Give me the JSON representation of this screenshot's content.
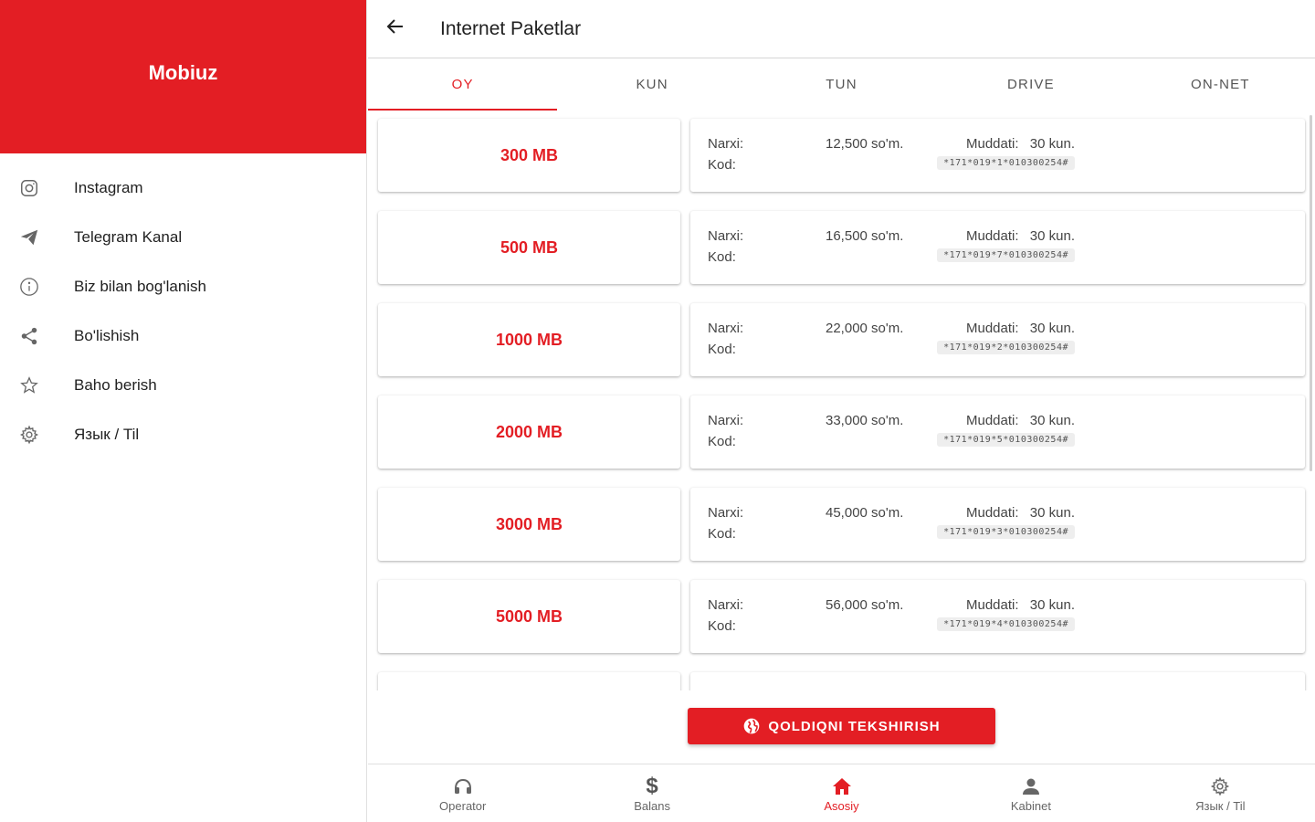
{
  "drawer": {
    "title": "Mobiuz",
    "header_color": "#e31e24",
    "items": [
      {
        "label": "Instagram",
        "icon": "instagram-icon"
      },
      {
        "label": "Telegram Kanal",
        "icon": "telegram-icon"
      },
      {
        "label": "Biz bilan bog'lanish",
        "icon": "info-icon"
      },
      {
        "label": "Bo'lishish",
        "icon": "share-icon"
      },
      {
        "label": "Baho berish",
        "icon": "star-icon"
      },
      {
        "label": "Язык / Til",
        "icon": "gear-icon"
      }
    ]
  },
  "appbar": {
    "title": "Internet Paketlar",
    "back_icon": "arrow-left-icon"
  },
  "tabs": [
    {
      "label": "OY",
      "active": true
    },
    {
      "label": "KUN",
      "active": false
    },
    {
      "label": "TUN",
      "active": false
    },
    {
      "label": "DRIVE",
      "active": false
    },
    {
      "label": "ON-NET",
      "active": false
    }
  ],
  "packages": [
    {
      "size": "300 MB",
      "narxi_label": "Narxi:",
      "price": "12,500 so'm.",
      "muddat_label": "Muddati:",
      "days": "30 kun.",
      "kod_label": "Kod:",
      "code": "*171*019*1*010300254#"
    },
    {
      "size": "500 MB",
      "narxi_label": "Narxi:",
      "price": "16,500 so'm.",
      "muddat_label": "Muddati:",
      "days": "30 kun.",
      "kod_label": "Kod:",
      "code": "*171*019*7*010300254#"
    },
    {
      "size": "1000 MB",
      "narxi_label": "Narxi:",
      "price": "22,000 so'm.",
      "muddat_label": "Muddati:",
      "days": "30 kun.",
      "kod_label": "Kod:",
      "code": "*171*019*2*010300254#"
    },
    {
      "size": "2000 MB",
      "narxi_label": "Narxi:",
      "price": "33,000 so'm.",
      "muddat_label": "Muddati:",
      "days": "30 kun.",
      "kod_label": "Kod:",
      "code": "*171*019*5*010300254#"
    },
    {
      "size": "3000 MB",
      "narxi_label": "Narxi:",
      "price": "45,000 so'm.",
      "muddat_label": "Muddati:",
      "days": "30 kun.",
      "kod_label": "Kod:",
      "code": "*171*019*3*010300254#"
    },
    {
      "size": "5000 MB",
      "narxi_label": "Narxi:",
      "price": "56,000 so'm.",
      "muddat_label": "Muddati:",
      "days": "30 kun.",
      "kod_label": "Kod:",
      "code": "*171*019*4*010300254#"
    }
  ],
  "check_button": {
    "label": "QOLDIQNI TEKSHIRISH",
    "icon": "globe-icon"
  },
  "bottom_nav": [
    {
      "label": "Operator",
      "icon": "headphones-icon",
      "active": false
    },
    {
      "label": "Balans",
      "icon": "dollar-icon",
      "active": false
    },
    {
      "label": "Asosiy",
      "icon": "home-icon",
      "active": true
    },
    {
      "label": "Kabinet",
      "icon": "person-icon",
      "active": false
    },
    {
      "label": "Язык / Til",
      "icon": "gear-icon",
      "active": false
    }
  ],
  "colors": {
    "accent": "#e31e24",
    "text": "#212121",
    "muted": "#666666"
  }
}
